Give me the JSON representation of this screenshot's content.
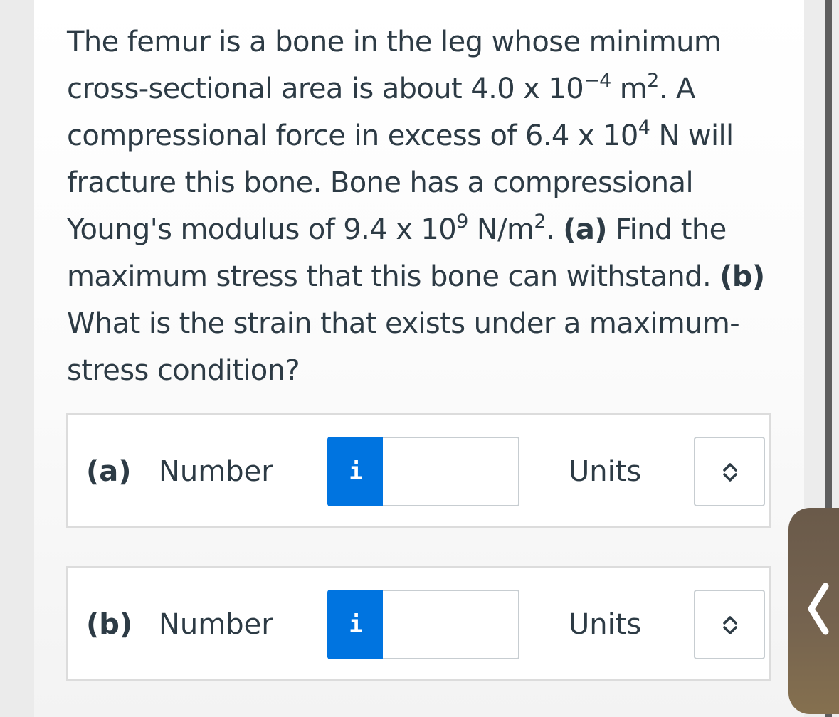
{
  "question": {
    "seg1": "The femur is a bone in the leg whose minimum cross-sectional area is about 4.0 x 10",
    "exp1": "−4",
    "seg2": " m",
    "exp2": "2",
    "seg3": ". A compressional force in excess of 6.4 x 10",
    "exp3": "4",
    "seg4": " N will fracture this bone. Bone has a compressional Young's modulus of 9.4 x 10",
    "exp4": "9",
    "seg5": " N/m",
    "exp5": "2",
    "seg6": ". ",
    "part_a_tag": "(a)",
    "part_a_text": " Find the maximum stress that this bone can withstand. ",
    "part_b_tag": "(b)",
    "part_b_text": " What is the strain that exists under a maximum-stress condition?"
  },
  "answers": [
    {
      "part_label": "(a)",
      "number_label": "Number",
      "info_icon_glyph": "i",
      "number_value": "",
      "units_label": "Units",
      "units_value": ""
    },
    {
      "part_label": "(b)",
      "number_label": "Number",
      "info_icon_glyph": "i",
      "number_value": "",
      "units_label": "Units",
      "units_value": ""
    }
  ],
  "colors": {
    "text": "#2d3b45",
    "info_button": "#0074e0",
    "input_border": "#c7cdd1",
    "handle": "#75634f"
  },
  "icons": {
    "info": "info-icon",
    "select": "up-down-chevron-icon",
    "handle": "chevron-left-icon"
  }
}
